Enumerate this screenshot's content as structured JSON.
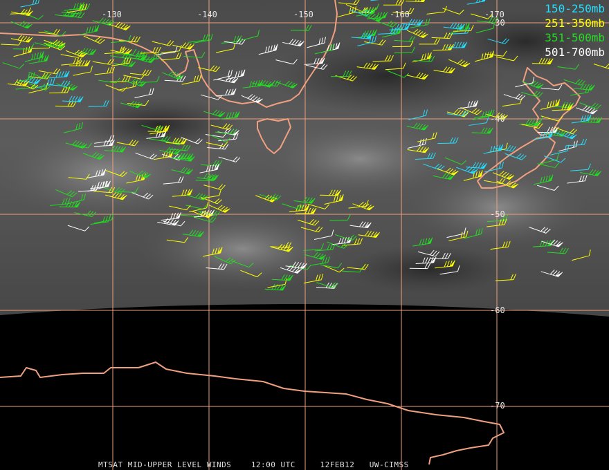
{
  "legend": [
    {
      "label": "150-250mb",
      "color": "#22e0ff"
    },
    {
      "label": "251-350mb",
      "color": "#ffff00"
    },
    {
      "label": "351-500mb",
      "color": "#22dd22"
    },
    {
      "label": "501-700mb",
      "color": "#ffffff"
    }
  ],
  "grid": {
    "lon_labels": [
      "-130",
      "-140",
      "-150",
      "-160",
      "-170"
    ],
    "lat_labels": [
      "-30",
      "-40",
      "-50",
      "-60",
      "-70"
    ],
    "color": "#f0a080"
  },
  "coast_color": "#f0a080",
  "footer": {
    "product": "MTSAT MID-UPPER LEVEL WINDS",
    "time": "12:00 UTC",
    "date": "12FEB12",
    "source": "UW-CIMSS"
  }
}
